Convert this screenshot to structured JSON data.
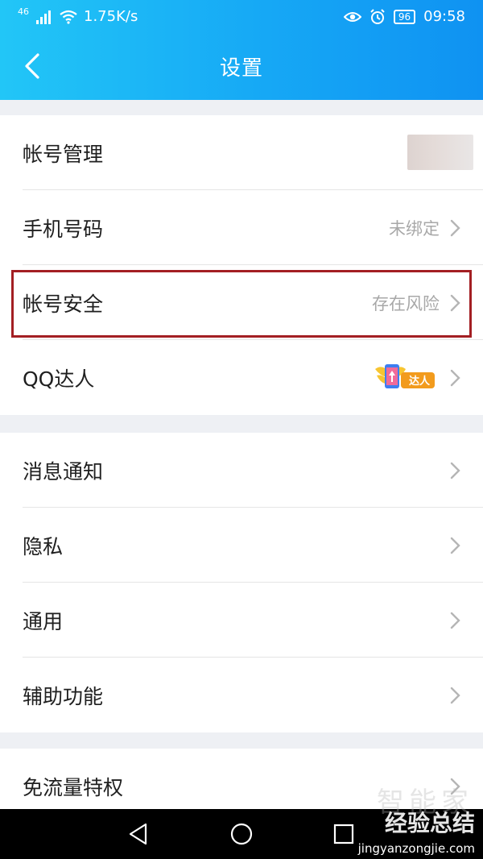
{
  "status_bar": {
    "network": "46",
    "speed": "1.75K/s",
    "battery": "96",
    "time": "09:58"
  },
  "header": {
    "title": "设置"
  },
  "groups": [
    {
      "items": [
        {
          "label": "帐号管理",
          "value": ""
        },
        {
          "label": "手机号码",
          "value": "未绑定"
        },
        {
          "label": "帐号安全",
          "value": "存在风险"
        },
        {
          "label": "QQ达人",
          "value": ""
        }
      ]
    },
    {
      "items": [
        {
          "label": "消息通知"
        },
        {
          "label": "隐私"
        },
        {
          "label": "通用"
        },
        {
          "label": "辅助功能"
        }
      ]
    },
    {
      "items": [
        {
          "label": "免流量特权"
        }
      ]
    }
  ],
  "badge": {
    "text": "达人"
  },
  "watermark": {
    "main": "经验总结",
    "sub": "jingyanzongjie.com",
    "faded": "智能家"
  },
  "colors": {
    "header_start": "#22c6f7",
    "header_end": "#0f92f2",
    "highlight_border": "#a31f23",
    "muted_text": "#a8a8a8"
  }
}
